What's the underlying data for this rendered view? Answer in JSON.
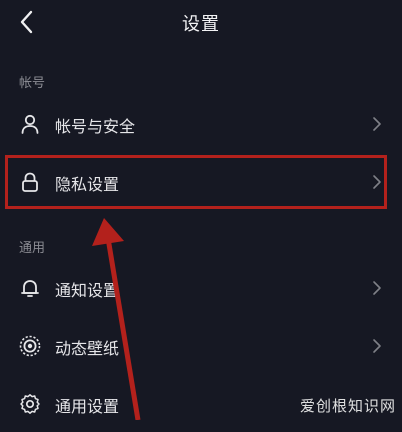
{
  "header": {
    "title": "设置"
  },
  "sections": [
    {
      "title": "帐号",
      "items": [
        {
          "label": "帐号与安全",
          "icon": "user-icon"
        },
        {
          "label": "隐私设置",
          "icon": "lock-icon"
        }
      ]
    },
    {
      "title": "通用",
      "items": [
        {
          "label": "通知设置",
          "icon": "bell-icon"
        },
        {
          "label": "动态壁纸",
          "icon": "live-wallpaper-icon"
        },
        {
          "label": "通用设置",
          "icon": "gear-icon"
        }
      ]
    }
  ],
  "annotation": {
    "highlight_color": "#b3211c"
  },
  "watermark": {
    "text": "爱创根知识网"
  }
}
